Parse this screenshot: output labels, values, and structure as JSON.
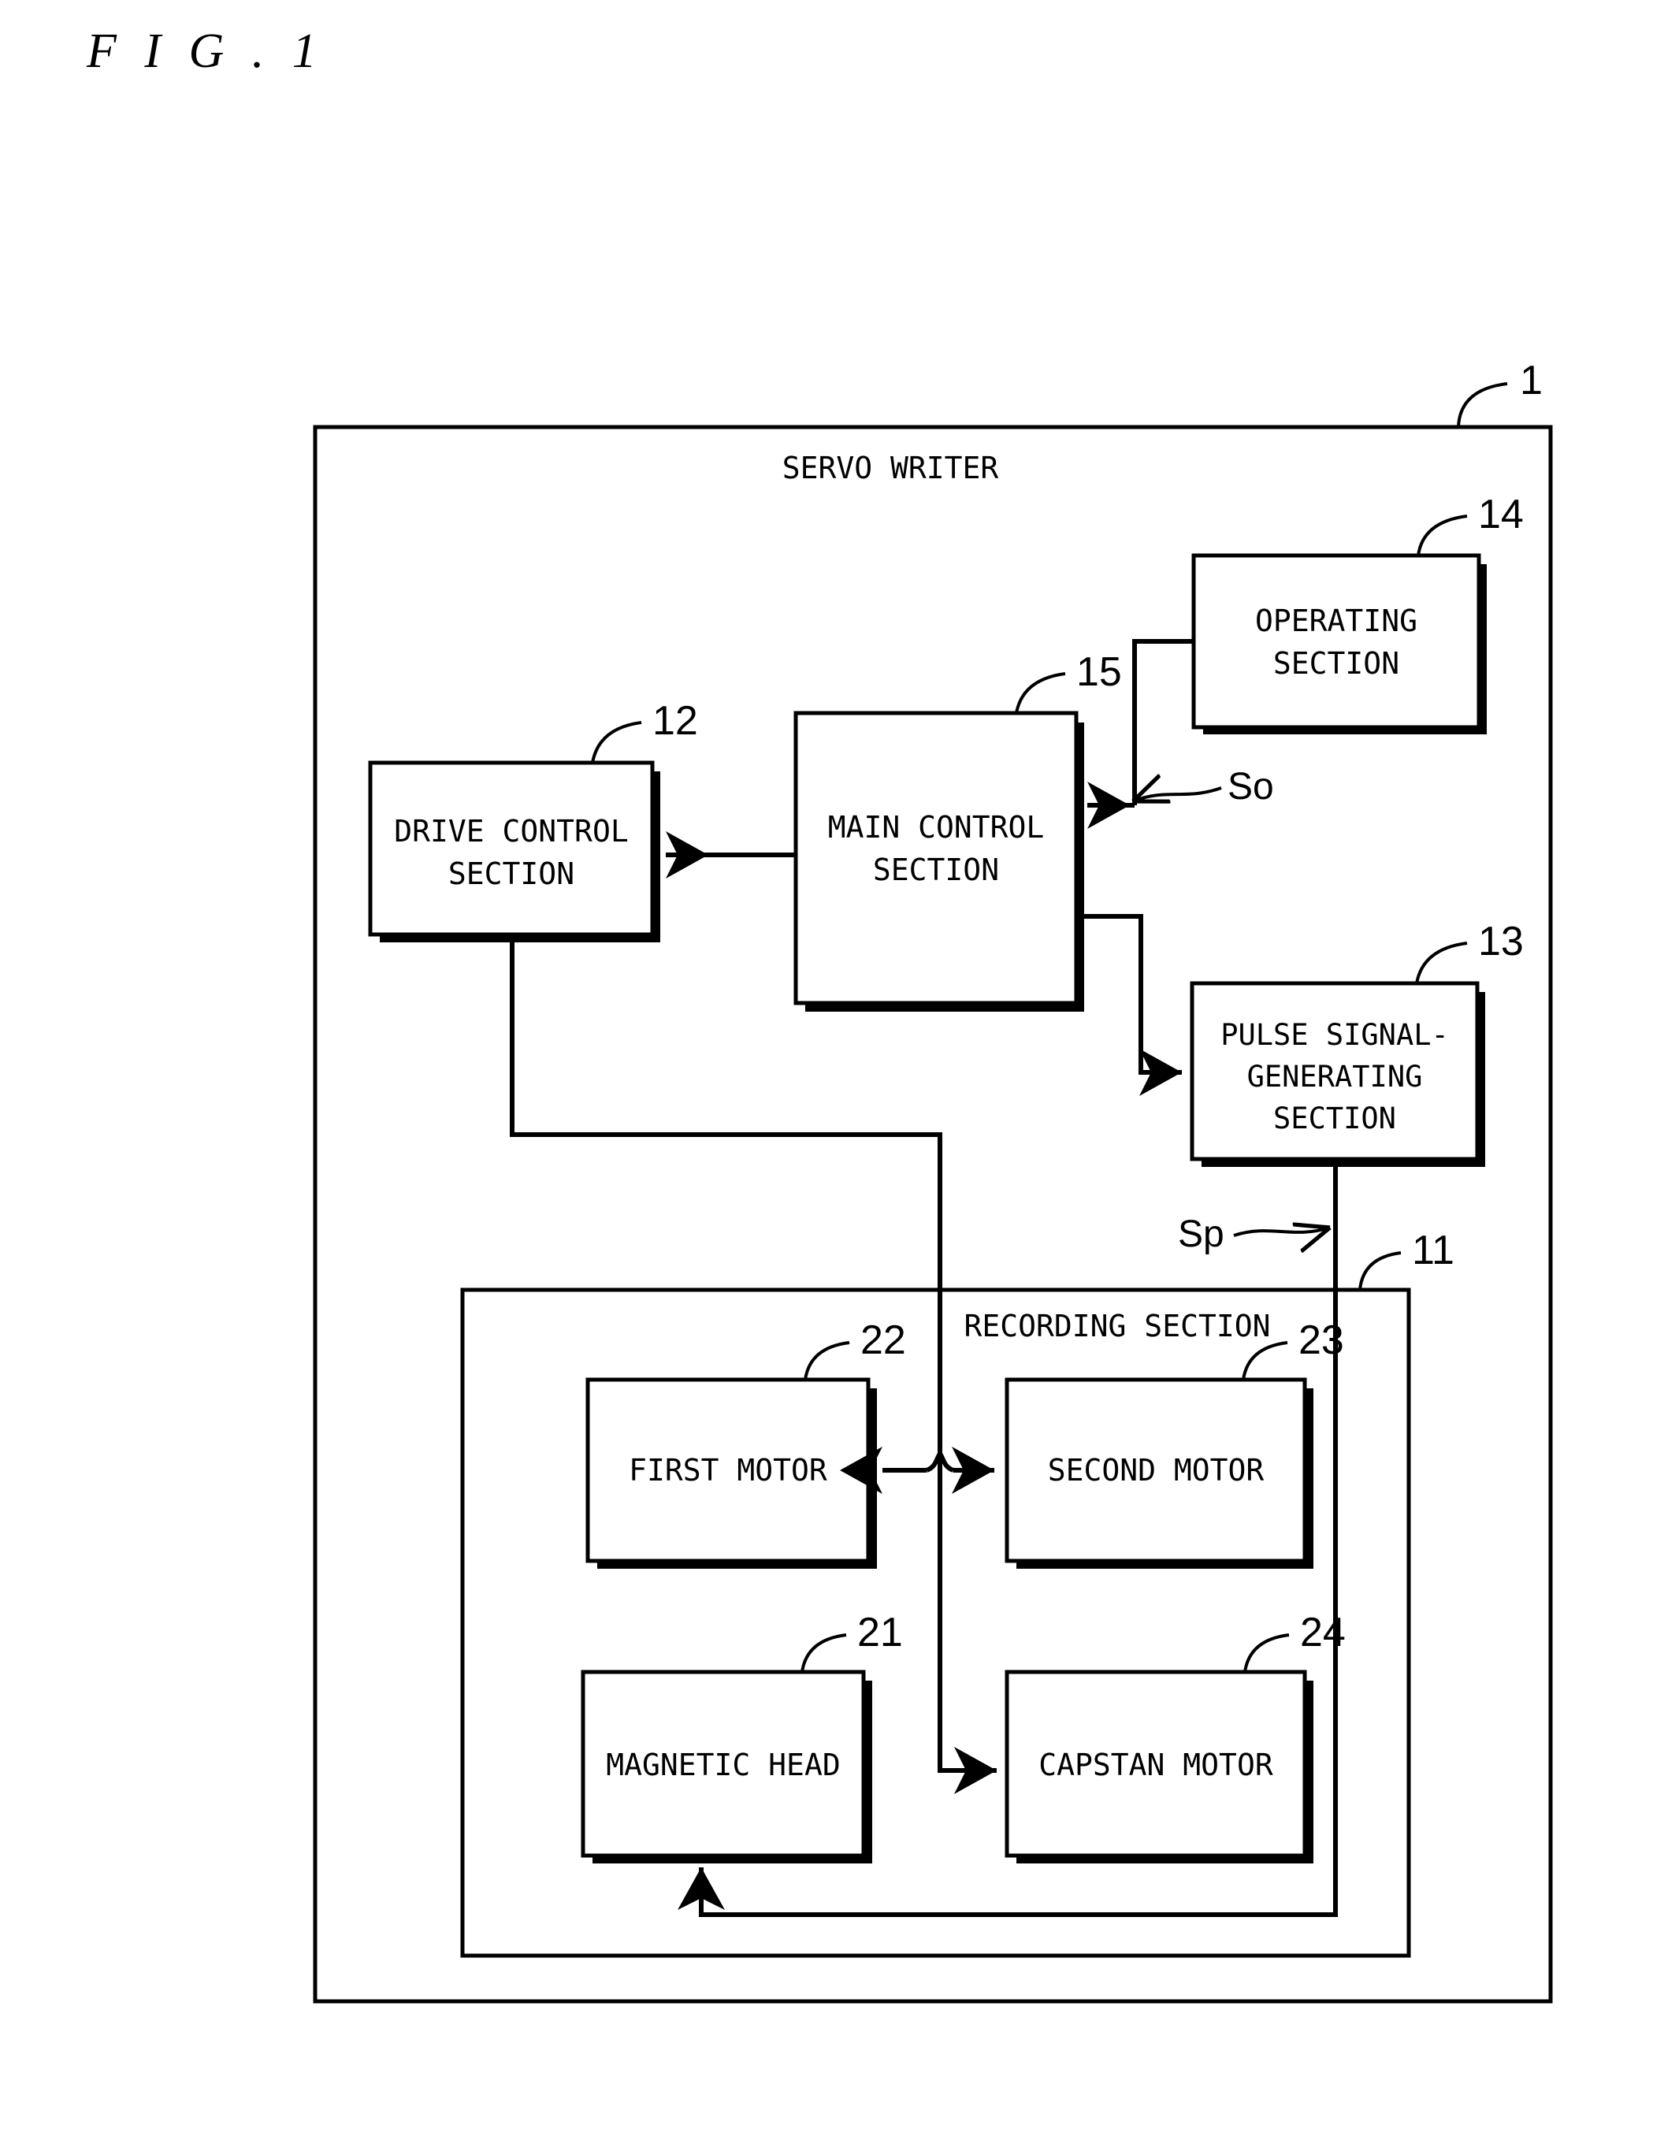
{
  "figure": {
    "title": "F I G . 1"
  },
  "outer_frame": {
    "name": "servo-writer",
    "title": "SERVO WRITER",
    "ref": "1"
  },
  "inner_frame": {
    "name": "recording-section",
    "title": "RECORDING SECTION",
    "ref": "11"
  },
  "blocks": [
    {
      "id": "operating-section",
      "ref": "14",
      "lines": [
        "OPERATING",
        "SECTION"
      ]
    },
    {
      "id": "main-control-section",
      "ref": "15",
      "lines": [
        "MAIN CONTROL",
        "SECTION"
      ]
    },
    {
      "id": "drive-control-section",
      "ref": "12",
      "lines": [
        "DRIVE CONTROL",
        "SECTION"
      ]
    },
    {
      "id": "pulse-signal-generating-section",
      "ref": "13",
      "lines": [
        "PULSE SIGNAL-",
        "GENERATING",
        "SECTION"
      ]
    },
    {
      "id": "first-motor",
      "ref": "22",
      "lines": [
        "FIRST MOTOR"
      ]
    },
    {
      "id": "second-motor",
      "ref": "23",
      "lines": [
        "SECOND MOTOR"
      ]
    },
    {
      "id": "magnetic-head",
      "ref": "21",
      "lines": [
        "MAGNETIC HEAD"
      ]
    },
    {
      "id": "capstan-motor",
      "ref": "24",
      "lines": [
        "CAPSTAN MOTOR"
      ]
    }
  ],
  "signals": [
    {
      "id": "so",
      "label": "So"
    },
    {
      "id": "sp",
      "label": "Sp"
    }
  ],
  "colors": {
    "ink": "#000000",
    "paper": "#ffffff"
  }
}
